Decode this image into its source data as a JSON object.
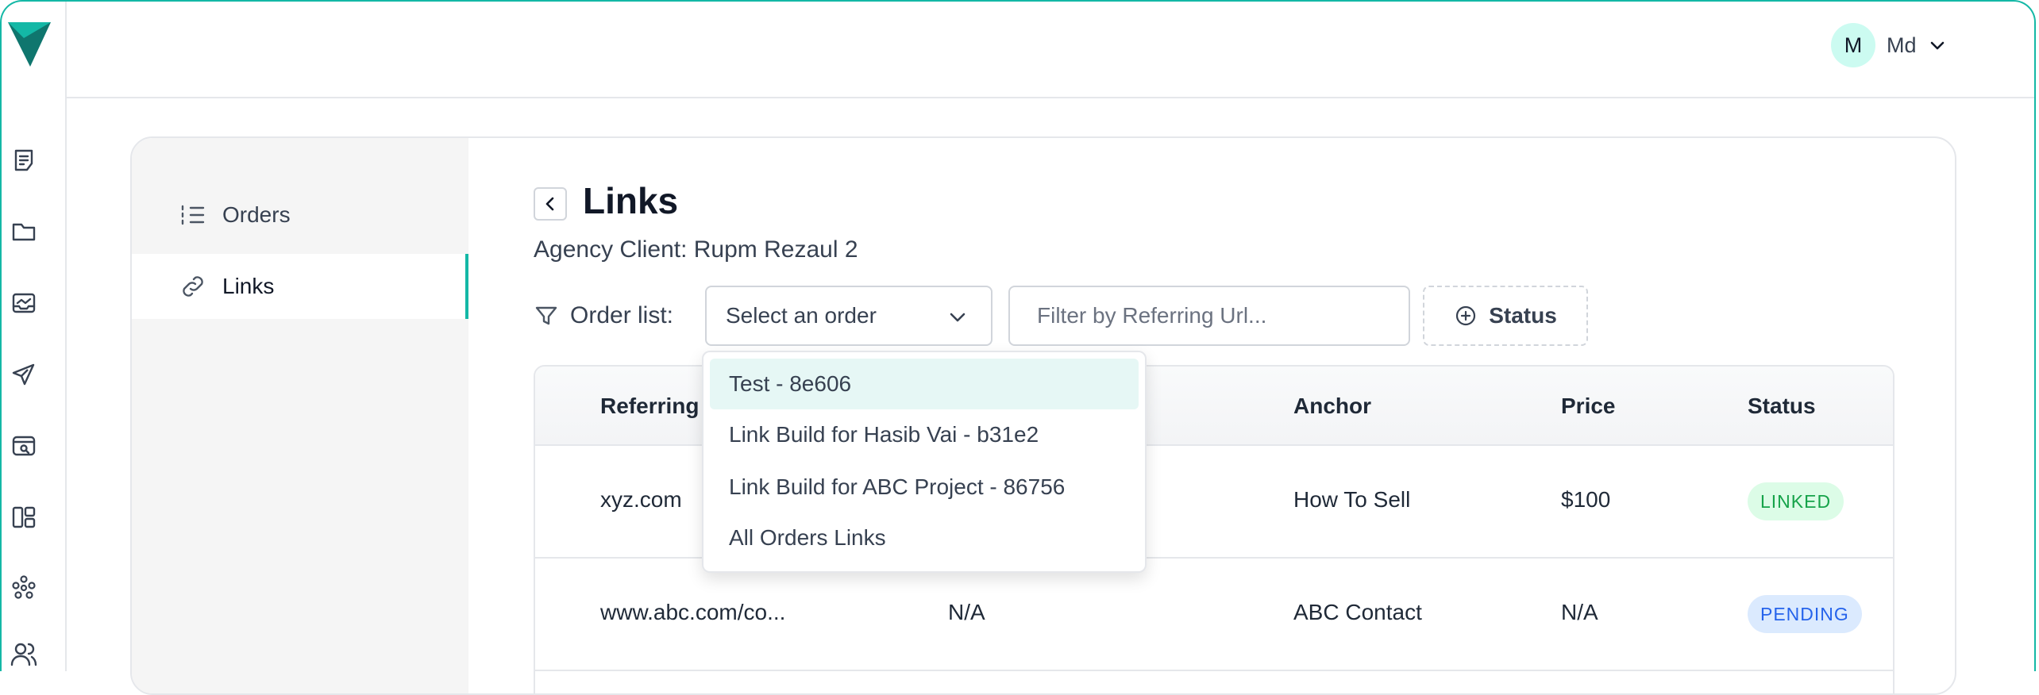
{
  "rail": {
    "icons": [
      "notes-icon",
      "folder-icon",
      "inbox-chart-icon",
      "send-icon",
      "window-search-icon",
      "layout-icon",
      "network-icon",
      "users-icon"
    ]
  },
  "header": {
    "user_initial": "M",
    "user_name": "Md"
  },
  "sidebar": {
    "items": [
      {
        "label": "Orders",
        "icon": "list-icon",
        "active": false
      },
      {
        "label": "Links",
        "icon": "link-icon",
        "active": true
      }
    ]
  },
  "page": {
    "title": "Links",
    "subtitle": "Agency Client: Rupm Rezaul 2"
  },
  "filters": {
    "order_label": "Order list:",
    "order_select_value": "Select an order",
    "referring_placeholder": "Filter by Referring Url...",
    "status_button_label": "Status"
  },
  "dropdown": {
    "options": [
      "Test - 8e606",
      "Link Build for Hasib Vai - b31e2",
      "Link Build for ABC Project - 86756",
      "All Orders Links"
    ],
    "highlighted_index": 0
  },
  "table": {
    "columns": [
      "Referring",
      "Anchor",
      "Price",
      "Status"
    ],
    "rows": [
      {
        "referring": "xyz.com",
        "target": "",
        "anchor": "How To Sell",
        "price": "$100",
        "status": "LINKED"
      },
      {
        "referring": "www.abc.com/co...",
        "target": "N/A",
        "anchor": "ABC Contact",
        "price": "N/A",
        "status": "PENDING"
      }
    ]
  },
  "colors": {
    "accent": "#14b8a6",
    "linked_badge": "#16a34a",
    "pending_badge": "#2563eb"
  }
}
